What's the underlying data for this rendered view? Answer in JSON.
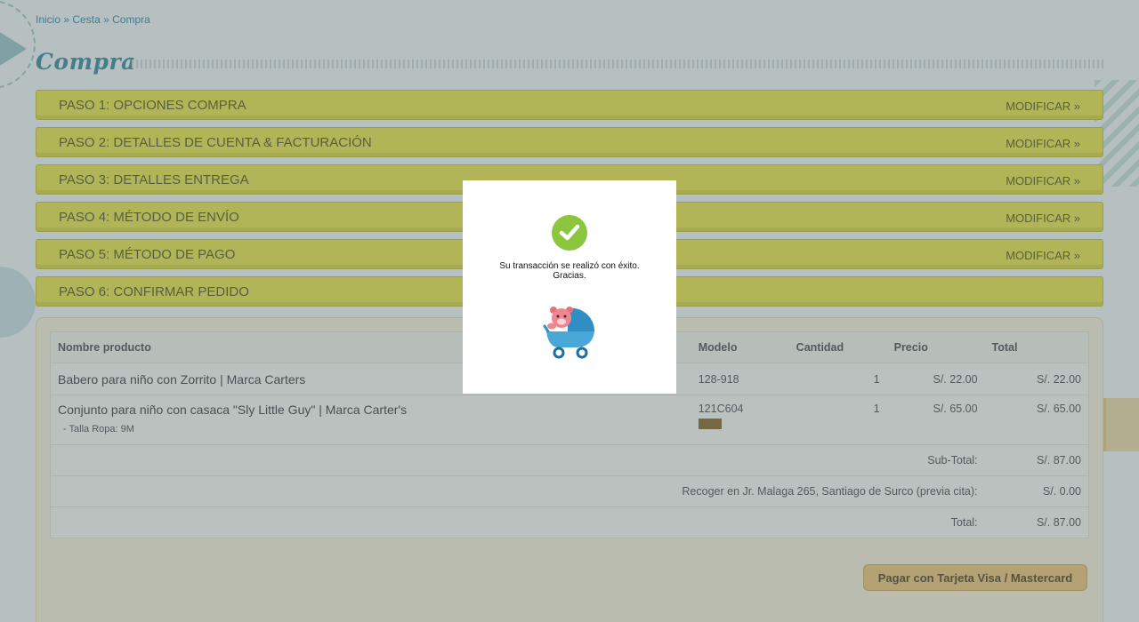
{
  "breadcrumb": {
    "items": [
      "Inicio",
      "Cesta",
      "Compra"
    ],
    "separator": "»"
  },
  "page": {
    "title": "Compra"
  },
  "steps": [
    {
      "label": "PASO 1: OPCIONES COMPRA",
      "modify": "MODIFICAR »"
    },
    {
      "label": "PASO 2: DETALLES DE CUENTA & FACTURACIÓN",
      "modify": "MODIFICAR »"
    },
    {
      "label": "PASO 3: DETALLES ENTREGA",
      "modify": "MODIFICAR »"
    },
    {
      "label": "PASO 4: MÉTODO DE ENVÍO",
      "modify": "MODIFICAR »"
    },
    {
      "label": "PASO 5: MÉTODO DE PAGO",
      "modify": "MODIFICAR »"
    },
    {
      "label": "PASO 6: CONFIRMAR PEDIDO",
      "modify": ""
    }
  ],
  "cart": {
    "headers": {
      "product": "Nombre producto",
      "model": "Modelo",
      "quantity": "Cantidad",
      "price": "Precio",
      "total": "Total"
    },
    "rows": [
      {
        "name": "Babero para niño con Zorrito | Marca Carters",
        "option": "",
        "model": "128-918",
        "quantity": "1",
        "price": "S/. 22.00",
        "total": "S/. 22.00"
      },
      {
        "name": "Conjunto para niño con casaca \"Sly Little Guy\" | Marca Carter's",
        "option": "- Talla Ropa: 9M",
        "model": "121C604",
        "quantity": "1",
        "price": "S/. 65.00",
        "total": "S/. 65.00"
      }
    ],
    "totals": [
      {
        "label": "Sub-Total:",
        "value": "S/. 87.00"
      },
      {
        "label": "Recoger en Jr. Malaga 265, Santiago de Surco (previa cita):",
        "value": "S/. 0.00"
      },
      {
        "label": "Total:",
        "value": "S/. 87.00"
      }
    ],
    "pay_button": "Pagar con Tarjeta Visa / Mastercard"
  },
  "modal": {
    "message_line1": "Su transacción se realizó con éxito.",
    "message_line2": "Gracias.",
    "icon": "check-circle-icon",
    "image": "baby-stroller-teddy-bear-icon"
  },
  "colors": {
    "step_bar": "#efe74a",
    "link": "#3a8aa8",
    "success_green": "#8cc63f",
    "pay_button": "#f2c97a"
  }
}
